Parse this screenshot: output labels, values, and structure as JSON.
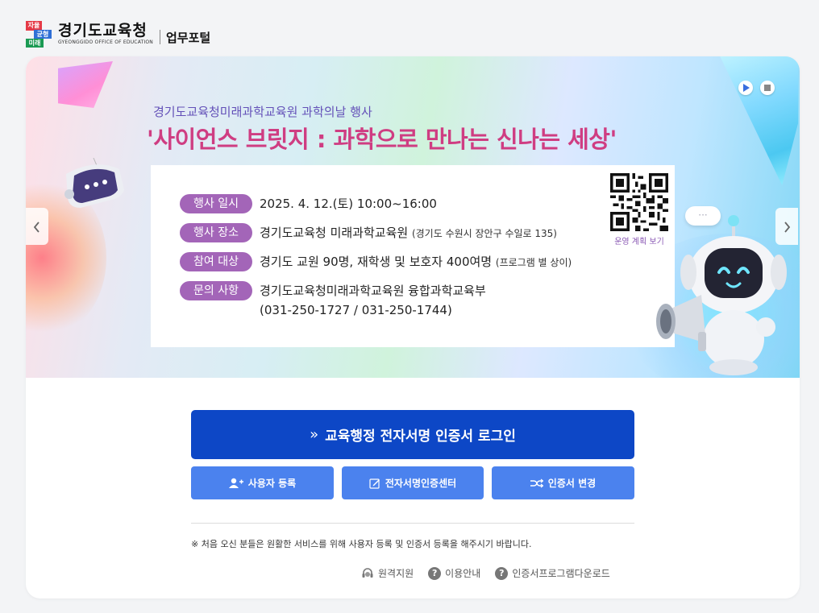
{
  "header": {
    "logo_badge_1": "자율",
    "logo_badge_2": "균형",
    "logo_badge_3": "미래",
    "logo_title": "경기도교육청",
    "logo_subtitle": "GYEONGGIDO OFFICE OF EDUCATION",
    "portal_name": "업무포털"
  },
  "banner": {
    "subtitle": "경기도교육청미래과학교육원 과학의날 행사",
    "title": "'사이언스 브릿지 : 과학으로 만나는 신나는 세상'",
    "rows": [
      {
        "label": "행사 일시",
        "value": "2025. 4. 12.(토) 10:00~16:00",
        "note": ""
      },
      {
        "label": "행사 장소",
        "value": "경기도교육청 미래과학교육원",
        "note": "(경기도 수원시 장안구 수일로 135)"
      },
      {
        "label": "참여 대상",
        "value": "경기도 교원 90명, 재학생 및 보호자 400여명",
        "note": "(프로그램 별 상이)"
      },
      {
        "label": "문의 사항",
        "value": "경기도교육청미래과학교육원 융합과학교육부",
        "value2": "(031-250-1727 / 031-250-1744)"
      }
    ],
    "qr_caption": "운영 계획 보기",
    "bubble_text": "···",
    "prev_icon": "chevron-left-icon",
    "next_icon": "chevron-right-icon"
  },
  "login": {
    "main_button": "교육행정 전자서명 인증서 로그인",
    "main_chevron": "»",
    "user_register": "사용자 등록",
    "cert_center": "전자서명인증센터",
    "cert_change": "인증서 변경",
    "notice": "※ 처음 오신 분들은 원활한 서비스를 위해 사용자 등록 및 인증서 등록을 해주시기 바랍니다.",
    "links": {
      "remote": "원격지원",
      "guide": "이용안내",
      "download": "인증서프로그램다운로드"
    }
  },
  "colors": {
    "primary": "#0d47c6",
    "secondary": "#4b82ee",
    "label_purple": "#a365b8",
    "title_pink": "#cf3d82"
  }
}
